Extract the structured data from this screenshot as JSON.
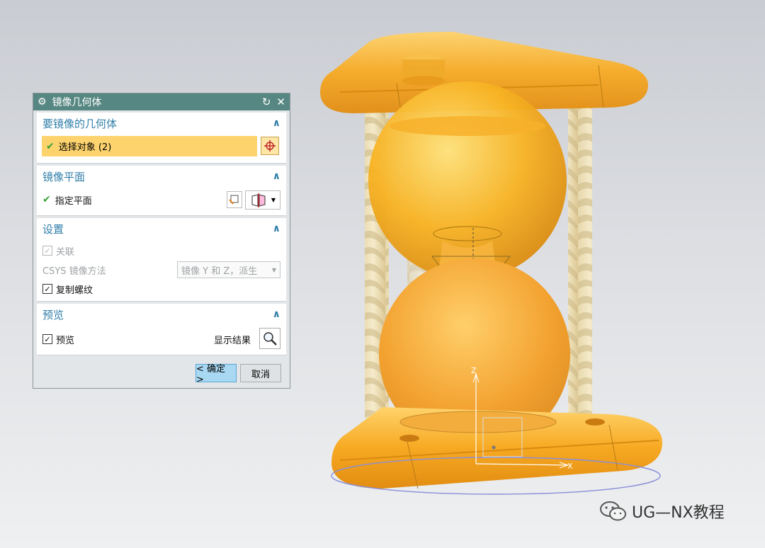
{
  "dialog": {
    "title": "镜像几何体",
    "reset_glyph": "↻",
    "close_glyph": "✕",
    "groups": {
      "geometry": {
        "header": "要镜像的几何体",
        "select_label": "选择对象 (2)"
      },
      "plane": {
        "header": "镜像平面",
        "specify_label": "指定平面"
      },
      "settings": {
        "header": "设置",
        "associative_label": "关联",
        "csys_label": "CSYS 镜像方法",
        "csys_value": "镜像 Y 和 Z，派生",
        "copy_threads_label": "复制螺纹"
      },
      "preview": {
        "header": "预览",
        "preview_label": "预览",
        "show_result_label": "显示结果"
      }
    },
    "ok_label": "< 确定 >",
    "cancel_label": "取消"
  },
  "viewport": {
    "axis_z": "Z",
    "axis_x": "X"
  },
  "watermark": {
    "text": "UG—NX教程"
  },
  "colors": {
    "title_bar": "#578782",
    "header_text": "#2f7ea8",
    "selection_row": "#fdd36e",
    "model": "#f5a623"
  }
}
